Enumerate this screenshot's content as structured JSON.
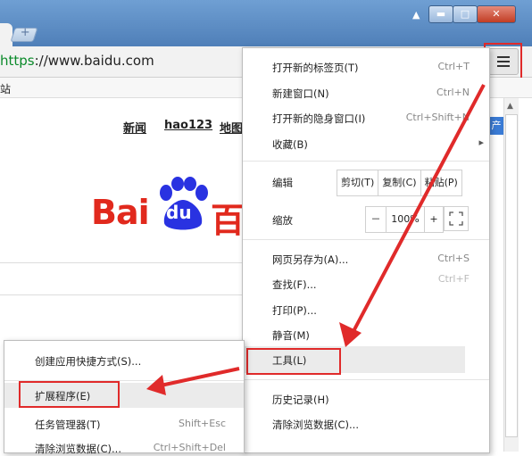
{
  "browser": {
    "url_scheme": "https",
    "url_rest": "://www.baidu.com",
    "bookmark_fragment": "站",
    "tab_new_glyph": "+",
    "menu_icon": "hamburger-menu-icon"
  },
  "window_controls": {
    "minimize": "▬",
    "maximize": "□",
    "close": "✕"
  },
  "page": {
    "links": [
      "新闻",
      "hao123",
      "地图"
    ],
    "logo_part1": "Bai",
    "logo_part2": "du",
    "logo_part3": "百",
    "side_badge": "产"
  },
  "chrome_menu": {
    "items_top": [
      {
        "label": "打开新的标签页(T)",
        "shortcut": "Ctrl+T"
      },
      {
        "label": "新建窗口(N)",
        "shortcut": "Ctrl+N"
      },
      {
        "label": "打开新的隐身窗口(I)",
        "shortcut": "Ctrl+Shift+N"
      },
      {
        "label": "收藏(B)",
        "shortcut": "▸"
      }
    ],
    "edit": {
      "label": "编辑",
      "cut": "剪切(T)",
      "copy": "复制(C)",
      "paste": "粘贴(P)"
    },
    "zoom": {
      "label": "缩放",
      "minus": "－",
      "value": "100%",
      "plus": "+"
    },
    "items_mid": [
      {
        "label": "网页另存为(A)...",
        "shortcut": "Ctrl+S"
      },
      {
        "label": "查找(F)...",
        "shortcut": "Ctrl+F"
      },
      {
        "label": "打印(P)...",
        "shortcut": ""
      },
      {
        "label": "静音(M)",
        "shortcut": ""
      },
      {
        "label": "工具(L)",
        "shortcut": ""
      }
    ],
    "items_bottom": [
      {
        "label": "历史记录(H)",
        "shortcut": ""
      },
      {
        "label": "清除浏览数据(C)...",
        "shortcut": ""
      }
    ]
  },
  "tools_submenu": {
    "items": [
      {
        "label": "创建应用快捷方式(S)...",
        "shortcut": ""
      },
      {
        "label": "扩展程序(E)",
        "shortcut": ""
      },
      {
        "label": "任务管理器(T)",
        "shortcut": "Shift+Esc"
      },
      {
        "label": "清除浏览数据(C)...",
        "shortcut": "Ctrl+Shift+Del"
      }
    ]
  },
  "annotation_color": "#e02a2a"
}
